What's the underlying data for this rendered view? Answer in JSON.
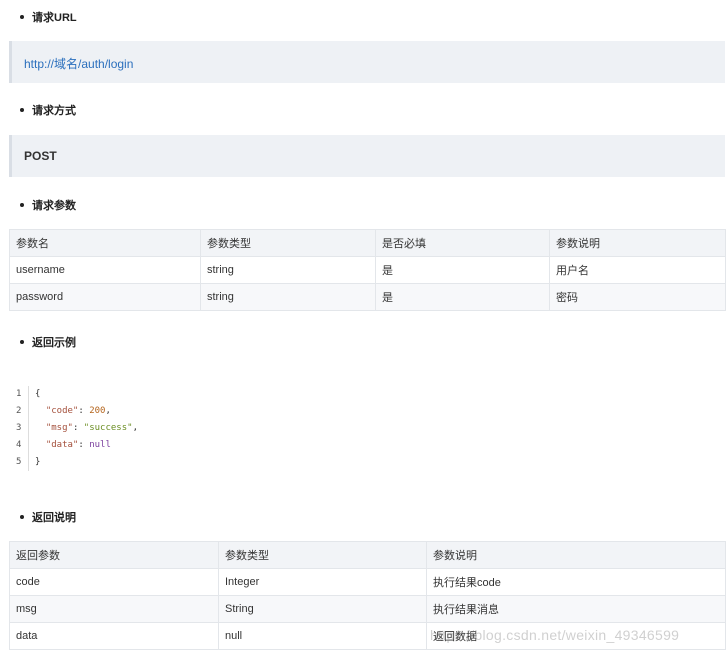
{
  "sections": {
    "url": "请求URL",
    "method": "请求方式",
    "params": "请求参数",
    "example": "返回示例",
    "response": "返回说明"
  },
  "url_value": "http://域名/auth/login",
  "method_value": "POST",
  "params_table": {
    "headers": [
      "参数名",
      "参数类型",
      "是否必填",
      "参数说明"
    ],
    "rows": [
      [
        "username",
        "string",
        "是",
        "用户名"
      ],
      [
        "password",
        "string",
        "是",
        "密码"
      ]
    ]
  },
  "code_example": {
    "line_numbers": [
      "1",
      "2",
      "3",
      "4",
      "5"
    ],
    "open": "{",
    "close": "}",
    "entries": [
      {
        "key": "\"code\"",
        "value": "200",
        "suffix": ","
      },
      {
        "key": "\"msg\"",
        "value": "\"success\"",
        "suffix": ","
      },
      {
        "key": "\"data\"",
        "value": "null",
        "suffix": ""
      }
    ]
  },
  "response_table": {
    "headers": [
      "返回参数",
      "参数类型",
      "参数说明"
    ],
    "rows": [
      [
        "code",
        "Integer",
        "执行结果code"
      ],
      [
        "msg",
        "String",
        "执行结果消息"
      ],
      [
        "data",
        "null",
        "返回数据"
      ]
    ]
  },
  "watermark": "https://blog.csdn.net/weixin_49346599"
}
